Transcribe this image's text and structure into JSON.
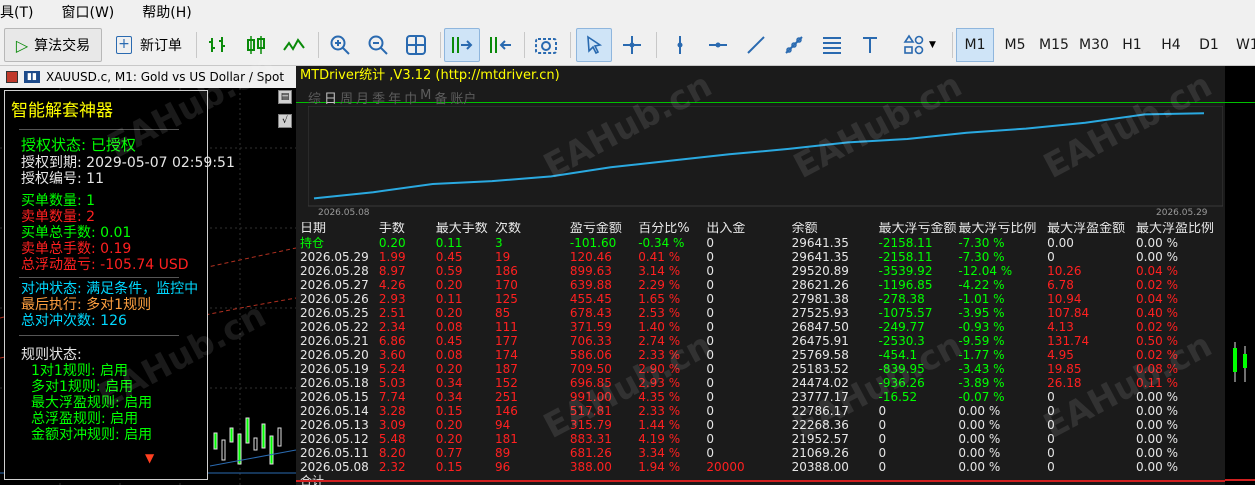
{
  "menu": [
    "具(T)",
    "窗口(W)",
    "帮助(H)"
  ],
  "toolbar": {
    "algo_trading": "算法交易",
    "new_order": "新订单",
    "timeframes": [
      "M1",
      "M5",
      "M15",
      "M30",
      "H1",
      "H4",
      "D1",
      "W1"
    ],
    "active_timeframe": "M1"
  },
  "chart": {
    "title": "XAUUSD.c, M1:  Gold vs US Dollar / Spot"
  },
  "panel": {
    "title": "智能解套神器",
    "auth_status": "授权状态: 已授权",
    "auth_expiry": "授权到期: 2029-05-07 02:59:51",
    "auth_number": "授权编号: 11",
    "buy_count": "买单数量: 1",
    "sell_count": "卖单数量: 2",
    "buy_lots": "买单总手数: 0.01",
    "sell_lots": "卖单总手数: 0.19",
    "floating_pl": "总浮动盈亏: -105.74 USD",
    "hedge_status": "对冲状态: 满足条件，监控中",
    "last_exec": "最后执行: 多对1规则",
    "hedge_count": "总对冲次数: 126",
    "rules_title": "规则状态:",
    "rules": [
      "1对1规则: 启用",
      "多对1规则: 启用",
      "最大浮盈规则: 启用",
      "总浮盈规则: 启用",
      "金额对冲规则: 启用"
    ]
  },
  "stats": {
    "title": "MTDriver统计 ,V3.12 (http://mtdriver.cn)",
    "tabs": [
      "综",
      "日",
      "周",
      "月",
      "季",
      "年",
      "巾",
      "M",
      "备",
      "账户"
    ],
    "curve_start": "2026.05.08",
    "curve_end": "2026.05.29",
    "watermark": "EAHub.cn",
    "headers": [
      "日期",
      "手数",
      "最大手数",
      "次数",
      "盈亏金额",
      "百分比%",
      "出入金",
      "余额",
      "最大浮亏金额",
      "最大浮亏比例",
      "最大浮盈金额",
      "最大浮盈比例"
    ],
    "rows": [
      [
        "持仓",
        "0.20",
        "0.11",
        "3",
        "-101.60",
        "-0.34 %",
        "0",
        "29641.35",
        "-2158.11",
        "-7.30 %",
        "0.00",
        "0.00 %"
      ],
      [
        "2026.05.29",
        "1.99",
        "0.45",
        "19",
        "120.46",
        "0.41 %",
        "0",
        "29641.35",
        "-2158.11",
        "-7.30 %",
        "0",
        "0.00 %"
      ],
      [
        "2026.05.28",
        "8.97",
        "0.59",
        "186",
        "899.63",
        "3.14 %",
        "0",
        "29520.89",
        "-3539.92",
        "-12.04 %",
        "10.26",
        "0.04 %"
      ],
      [
        "2026.05.27",
        "4.26",
        "0.20",
        "170",
        "639.88",
        "2.29 %",
        "0",
        "28621.26",
        "-1196.85",
        "-4.22 %",
        "6.78",
        "0.02 %"
      ],
      [
        "2026.05.26",
        "2.93",
        "0.11",
        "125",
        "455.45",
        "1.65 %",
        "0",
        "27981.38",
        "-278.38",
        "-1.01 %",
        "10.94",
        "0.04 %"
      ],
      [
        "2026.05.25",
        "2.51",
        "0.20",
        "85",
        "678.43",
        "2.53 %",
        "0",
        "27525.93",
        "-1075.57",
        "-3.95 %",
        "107.84",
        "0.40 %"
      ],
      [
        "2026.05.22",
        "2.34",
        "0.08",
        "111",
        "371.59",
        "1.40 %",
        "0",
        "26847.50",
        "-249.77",
        "-0.93 %",
        "4.13",
        "0.02 %"
      ],
      [
        "2026.05.21",
        "6.86",
        "0.45",
        "177",
        "706.33",
        "2.74 %",
        "0",
        "26475.91",
        "-2530.3",
        "-9.59 %",
        "131.74",
        "0.50 %"
      ],
      [
        "2026.05.20",
        "3.60",
        "0.08",
        "174",
        "586.06",
        "2.33 %",
        "0",
        "25769.58",
        "-454.1",
        "-1.77 %",
        "4.95",
        "0.02 %"
      ],
      [
        "2026.05.19",
        "5.24",
        "0.20",
        "187",
        "709.50",
        "2.90 %",
        "0",
        "25183.52",
        "-839.95",
        "-3.43 %",
        "19.85",
        "0.08 %"
      ],
      [
        "2026.05.18",
        "5.03",
        "0.34",
        "152",
        "696.85",
        "2.93 %",
        "0",
        "24474.02",
        "-936.26",
        "-3.89 %",
        "26.18",
        "0.11 %"
      ],
      [
        "2026.05.15",
        "7.74",
        "0.34",
        "251",
        "991.00",
        "4.35 %",
        "0",
        "23777.17",
        "-16.52",
        "-0.07 %",
        "0",
        "0.00 %"
      ],
      [
        "2026.05.14",
        "3.28",
        "0.15",
        "146",
        "517.81",
        "2.33 %",
        "0",
        "22786.17",
        "0",
        "0.00 %",
        "0",
        "0.00 %"
      ],
      [
        "2026.05.13",
        "3.09",
        "0.20",
        "94",
        "315.79",
        "1.44 %",
        "0",
        "22268.36",
        "0",
        "0.00 %",
        "0",
        "0.00 %"
      ],
      [
        "2026.05.12",
        "5.48",
        "0.20",
        "181",
        "883.31",
        "4.19 %",
        "0",
        "21952.57",
        "0",
        "0.00 %",
        "0",
        "0.00 %"
      ],
      [
        "2026.05.11",
        "8.20",
        "0.77",
        "89",
        "681.26",
        "3.34 %",
        "0",
        "21069.26",
        "0",
        "0.00 %",
        "0",
        "0.00 %"
      ],
      [
        "2026.05.08",
        "2.32",
        "0.15",
        "96",
        "388.00",
        "1.94 %",
        "20000",
        "20388.00",
        "0",
        "0.00 %",
        "0",
        "0.00 %"
      ],
      [
        "合计",
        "",
        "",
        "",
        "",
        "",
        "",
        "",
        "",
        "",
        "",
        ""
      ]
    ]
  },
  "colors": {
    "green": "#00ff00",
    "red": "#ff2020",
    "yellow": "#ffff00",
    "cyan": "#00d8ff",
    "white": "#e6e6e6",
    "curve": "#2aa9e0",
    "hline": "#00c000"
  }
}
